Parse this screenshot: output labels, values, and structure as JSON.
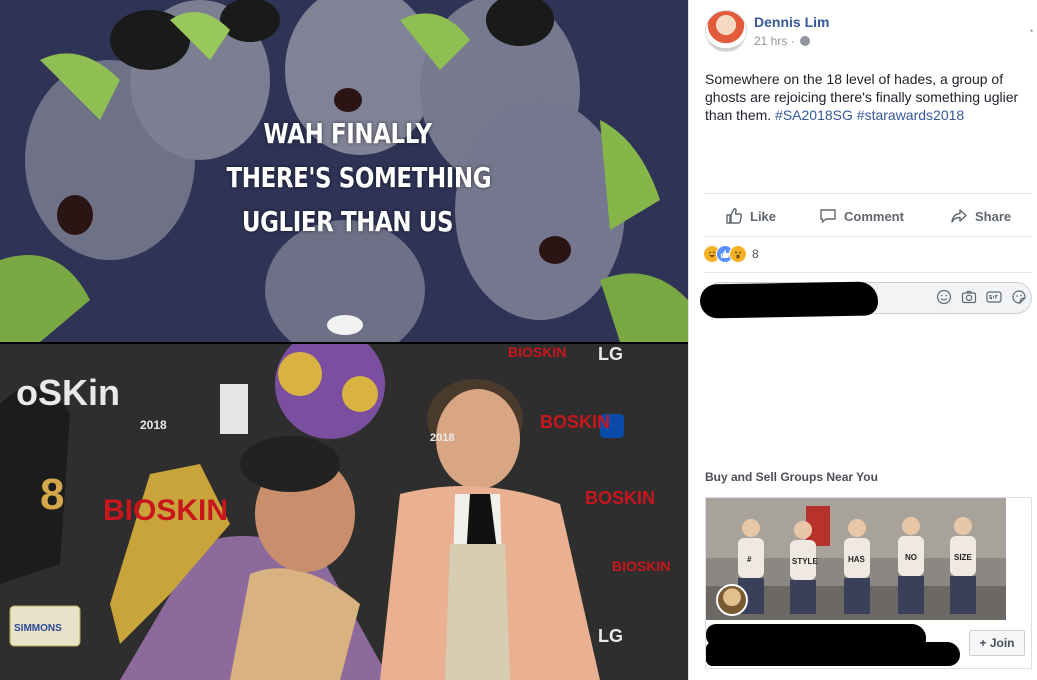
{
  "meme": {
    "caption_lines": [
      "WAH FINALLY",
      "THERE'S SOMETHING",
      "UGLIER THAN US"
    ],
    "backdrop": {
      "sponsor_bioskin_1": "oSKin",
      "sponsor_bioskin_2": "BIOSKIN",
      "sponsor_bioskin_3": "BIOSKIN",
      "sponsor_bioskin_4": "BOSKIN",
      "sponsor_bioskin_5": "BOSKIN",
      "sponsor_bioskin_6": "BIOSKIN",
      "year_1": "2018",
      "year_2": "2018",
      "lg_1": "LG",
      "lg_2": "LG",
      "simmons": "SIMMONS",
      "eight": "8"
    }
  },
  "post": {
    "author": "Dennis Lim",
    "time": "21 hrs",
    "separator": "·",
    "more_label": "···",
    "text": "Somewhere on the 18 level of hades, a group of ghosts are rejoicing there's finally something uglier than them.",
    "hashtags": [
      "#SA2018SG",
      "#starawards2018"
    ],
    "actions": {
      "like": "Like",
      "comment": "Comment",
      "share": "Share"
    },
    "reactions": {
      "types": [
        "haha",
        "like",
        "wow"
      ],
      "count": "8"
    }
  },
  "suggestions": {
    "title": "Buy and Sell Groups Near You",
    "image_shirt_words": [
      "#",
      "STYLE",
      "HAS",
      "NO",
      "SIZE"
    ],
    "join_label": "+ Join"
  },
  "colors": {
    "link": "#365899",
    "panel_border": "#dddfe2",
    "muted": "#90949c",
    "action": "#606770",
    "backdrop_red": "#c8161d"
  }
}
